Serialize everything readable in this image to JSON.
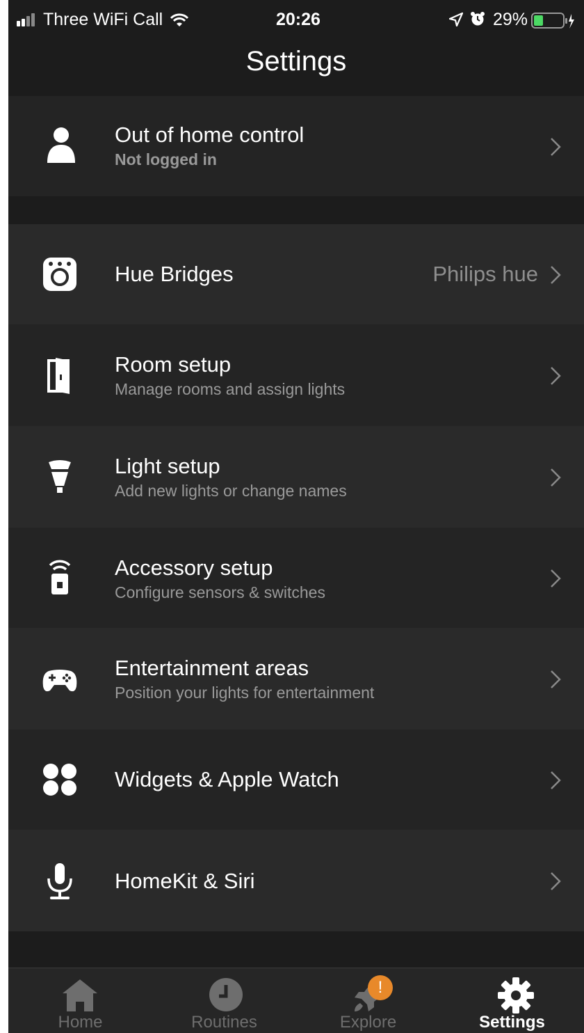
{
  "status_bar": {
    "carrier": "Three WiFi Call",
    "time": "20:26",
    "battery": "29%"
  },
  "header": {
    "title": "Settings"
  },
  "rows": [
    {
      "title": "Out of home control",
      "subtitle": "Not logged in",
      "icon": "person-icon"
    },
    {
      "title": "Hue Bridges",
      "value": "Philips hue",
      "icon": "bridge-icon"
    },
    {
      "title": "Room setup",
      "subtitle": "Manage rooms and assign lights",
      "icon": "door-icon"
    },
    {
      "title": "Light setup",
      "subtitle": "Add new lights or change names",
      "icon": "bulb-icon"
    },
    {
      "title": "Accessory setup",
      "subtitle": "Configure sensors & switches",
      "icon": "accessory-icon"
    },
    {
      "title": "Entertainment areas",
      "subtitle": "Position your lights for entertainment",
      "icon": "gamepad-icon"
    },
    {
      "title": "Widgets & Apple Watch",
      "icon": "widgets-icon"
    },
    {
      "title": "HomeKit & Siri",
      "icon": "microphone-icon"
    }
  ],
  "tabs": [
    {
      "label": "Home",
      "icon": "home-icon"
    },
    {
      "label": "Routines",
      "icon": "clock-icon"
    },
    {
      "label": "Explore",
      "icon": "rocket-icon",
      "badge": "!"
    },
    {
      "label": "Settings",
      "icon": "gear-icon",
      "active": true
    }
  ],
  "colors": {
    "background": "#1c1c1c",
    "row": "#2a2a2a",
    "badge": "#e8892a",
    "subtitle": "#9a9a9a"
  }
}
